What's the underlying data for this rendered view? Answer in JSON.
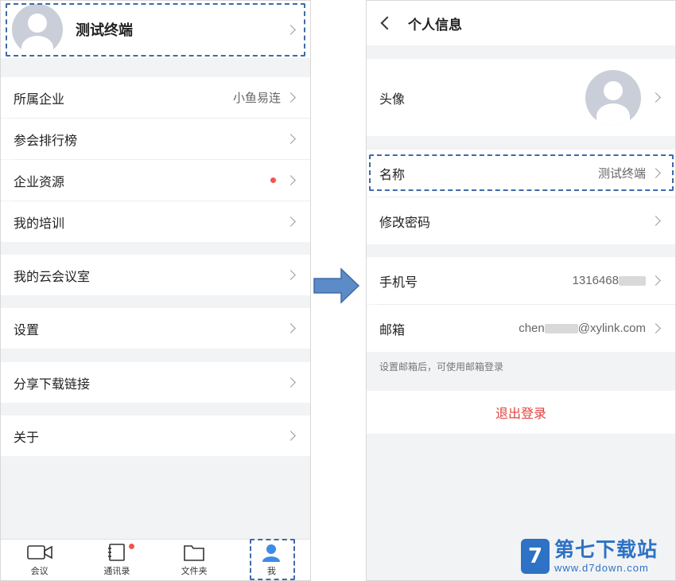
{
  "left": {
    "profile_name": "测试终端",
    "menu": [
      {
        "label": "所属企业",
        "value": "小鱼易连"
      },
      {
        "label": "参会排行榜"
      },
      {
        "label": "企业资源"
      },
      {
        "label": "我的培训"
      },
      {
        "label": "我的云会议室"
      },
      {
        "label": "设置"
      },
      {
        "label": "分享下载链接"
      },
      {
        "label": "关于"
      }
    ],
    "tabs": [
      "会议",
      "通讯录",
      "文件夹",
      "我"
    ]
  },
  "right": {
    "title": "个人信息",
    "avatar_label": "头像",
    "name_label": "名称",
    "name_value": "测试终端",
    "password_label": "修改密码",
    "phone_label": "手机号",
    "phone_value": "1316468",
    "email_label": "邮箱",
    "email_prefix": "chen",
    "email_suffix": "@xylink.com",
    "email_hint": "设置邮箱后，可使用邮箱登录",
    "logout": "退出登录"
  },
  "watermark": {
    "title": "第七下载站",
    "url": "www.d7down.com"
  },
  "colors": {
    "accent": "#3f6aa8",
    "badge": "#f0554e",
    "logout": "#e0443c",
    "tab_active": "#3d8be8"
  }
}
